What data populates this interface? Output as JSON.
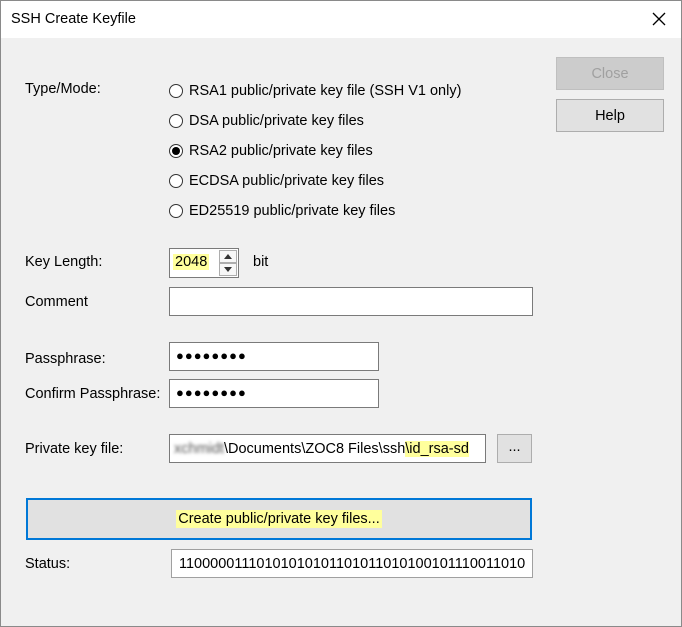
{
  "window": {
    "title": "SSH Create Keyfile"
  },
  "buttons": {
    "close": "Close",
    "help": "Help",
    "browse": "...",
    "create": "Create public/private key files..."
  },
  "type_mode": {
    "label": "Type/Mode:",
    "options": [
      {
        "label": "RSA1 public/private key file (SSH V1 only)",
        "checked": false
      },
      {
        "label": "DSA public/private key files",
        "checked": false
      },
      {
        "label": "RSA2 public/private key files",
        "checked": true
      },
      {
        "label": "ECDSA public/private key files",
        "checked": false
      },
      {
        "label": "ED25519 public/private key files",
        "checked": false
      }
    ]
  },
  "key_length": {
    "label": "Key Length:",
    "value": "2048",
    "unit": "bit"
  },
  "comment": {
    "label": "Comment",
    "value": ""
  },
  "passphrase": {
    "label": "Passphrase:",
    "value": "●●●●●●●●"
  },
  "confirm_passphrase": {
    "label": "Confirm Passphrase:",
    "value": "●●●●●●●●"
  },
  "private_key_file": {
    "label": "Private key file:",
    "user_part": "xchmidt",
    "path_mid": "\\Documents\\ZOC8 Files\\ssh",
    "file_part": "\\id_rsa-sd"
  },
  "status": {
    "label": "Status:",
    "value": "11000001110101010101101011010100101110011010"
  }
}
